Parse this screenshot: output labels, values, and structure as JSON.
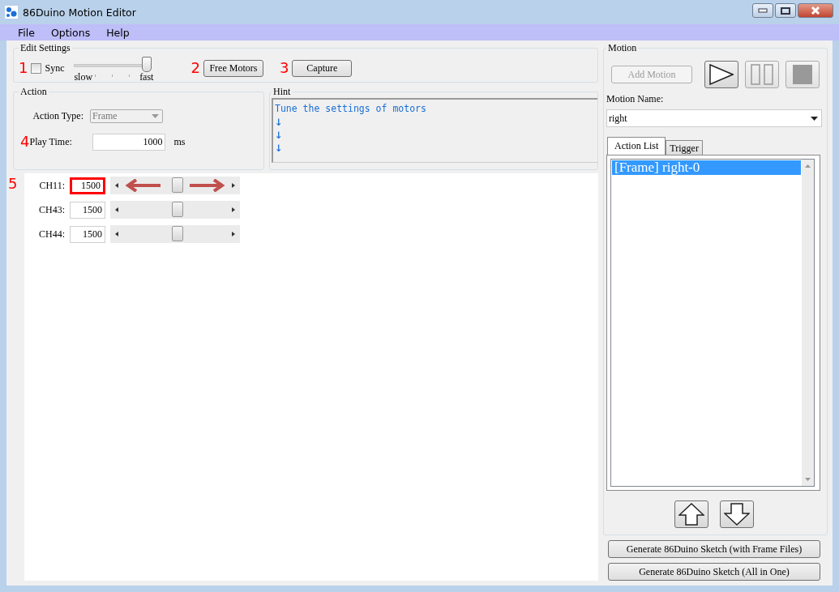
{
  "window": {
    "title": "86Duino Motion Editor"
  },
  "menu": [
    "File",
    "Options",
    "Help"
  ],
  "annotations": [
    "1",
    "2",
    "3",
    "4",
    "5"
  ],
  "edit_settings": {
    "title": "Edit Settings",
    "sync": {
      "label": "Sync",
      "checked": false
    },
    "speed": {
      "min_label": "slow",
      "max_label": "fast",
      "level": 0.95
    },
    "buttons": [
      "Free Motors",
      "Capture"
    ]
  },
  "action": {
    "title": "Action",
    "type_label": "Action Type:",
    "type_value": "Frame",
    "play_time_label": "Play Time:",
    "play_time": "1000",
    "unit": "ms"
  },
  "hint": {
    "title": "Hint",
    "lines": [
      "Tune the settings of motors",
      "↓",
      "↓",
      "↓"
    ]
  },
  "channels": [
    {
      "name": "CH11:",
      "value": "1500",
      "level": 0.5,
      "highlighted": true
    },
    {
      "name": "CH43:",
      "value": "1500",
      "level": 0.5,
      "highlighted": false
    },
    {
      "name": "CH44:",
      "value": "1500",
      "level": 0.5,
      "highlighted": false
    }
  ],
  "motion": {
    "title": "Motion",
    "add_button": {
      "label": "Add Motion",
      "disabled": true
    },
    "controls": [
      {
        "kind": "play",
        "disabled": false
      },
      {
        "kind": "pause",
        "disabled": true
      },
      {
        "kind": "stop",
        "disabled": true
      }
    ],
    "name_label": "Motion Name:",
    "name_value": "right",
    "tabs": [
      {
        "label": "Action List",
        "selected": true
      },
      {
        "label": "Trigger",
        "selected": false
      }
    ],
    "list": [
      {
        "label": "[Frame] right-0",
        "selected": true
      }
    ]
  },
  "generate_buttons": [
    "Generate 86Duino Sketch (with Frame Files)",
    "Generate 86Duino Sketch (All in One)"
  ]
}
